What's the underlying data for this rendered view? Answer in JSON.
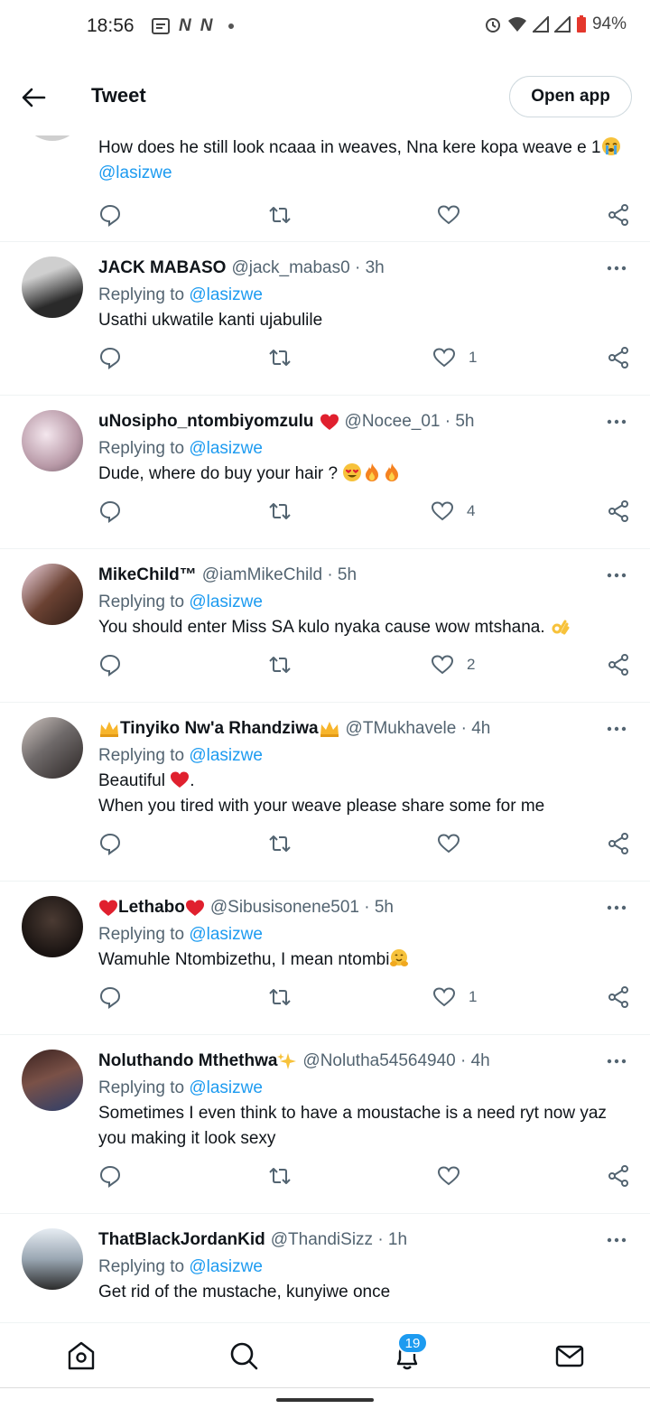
{
  "status": {
    "time": "18:56",
    "battery": "94%"
  },
  "topbar": {
    "title": "Tweet",
    "open_app": "Open app"
  },
  "partial_tweet": {
    "text": "How does he still look ncaaa in weaves, Nna kere kopa weave e 1",
    "mention": "@lasizwe"
  },
  "replying_label": "Replying to",
  "reply_target": "@lasizwe",
  "tweets": [
    {
      "name": "JACK MABASO",
      "handle": "@jack_mabas0 · 3h",
      "text": "Usathi ukwatile kanti ujabulile",
      "likes": "1"
    },
    {
      "name": "uNosipho_ntombiyomzulu",
      "handle": "@Nocee_01 · 5h",
      "text": "Dude, where do buy your hair ? ",
      "likes": "4"
    },
    {
      "name": "MikeChild™",
      "handle": "@iamMikeChild · 5h",
      "text": "You should enter Miss SA kulo nyaka cause wow mtshana. ",
      "likes": "2"
    },
    {
      "name": "Tinyiko Nw'a Rhandziwa",
      "handle": "@TMukhavele · 4h",
      "text": "Beautiful ",
      "text_after": ".",
      "text2": "When you tired with your weave please share some for me",
      "likes": ""
    },
    {
      "name": "Lethabo",
      "handle": "@Sibusisonene501 · 5h",
      "text": "Wamuhle Ntombizethu, I mean ntombi",
      "likes": "1"
    },
    {
      "name": "Noluthando Mthethwa",
      "handle": "@Nolutha54564940 · 4h",
      "text": "Sometimes I even think to have a moustache is a need ryt now yaz you making it look sexy",
      "likes": ""
    },
    {
      "name": "ThatBlackJordanKid",
      "handle": "@ThandiSizz · 1h",
      "text": "Get rid of the mustache, kunyiwe once",
      "likes": ""
    }
  ],
  "nav": {
    "notifications_badge": "19"
  }
}
